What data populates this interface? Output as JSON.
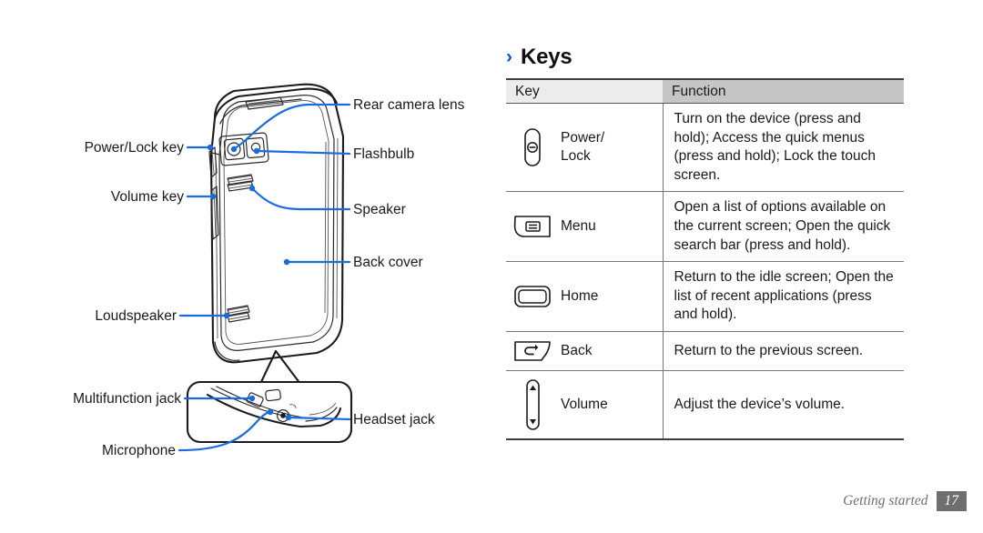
{
  "colors": {
    "accent_blue": "#0d4ff0",
    "leader_blue": "#1a6ae0",
    "header_key_bg": "#ececec",
    "header_function_bg": "#c6c6c6",
    "rule": "#777777",
    "footer_gray": "#6e6e6e",
    "ink": "#1a1a1a"
  },
  "heading": {
    "chevron": "›",
    "text": "Keys"
  },
  "diagram": {
    "labels_left": [
      {
        "text": "Power/Lock key",
        "name": "power-lock-key"
      },
      {
        "text": "Volume key",
        "name": "volume-key"
      },
      {
        "text": "Loudspeaker",
        "name": "loudspeaker"
      },
      {
        "text": "Multifunction jack",
        "name": "multifunction-jack"
      },
      {
        "text": "Microphone",
        "name": "microphone"
      }
    ],
    "labels_right": [
      {
        "text": "Rear camera lens",
        "name": "rear-camera-lens"
      },
      {
        "text": "Flashbulb",
        "name": "flashbulb"
      },
      {
        "text": "Speaker",
        "name": "speaker"
      },
      {
        "text": "Back cover",
        "name": "back-cover"
      },
      {
        "text": "Headset jack",
        "name": "headset-jack"
      }
    ]
  },
  "table": {
    "headers": {
      "key": "Key",
      "function": "Function"
    },
    "rows": [
      {
        "icon": "power-lock-key-icon",
        "name": "Power/\nLock",
        "name_lines": [
          "Power/",
          "Lock"
        ],
        "function": "Turn on the device (press and hold); Access the quick menus (press and hold); Lock the touch screen."
      },
      {
        "icon": "menu-key-icon",
        "name": "Menu",
        "name_lines": [
          "Menu"
        ],
        "function": "Open a list of options available on the current screen; Open the quick search bar (press and hold)."
      },
      {
        "icon": "home-key-icon",
        "name": "Home",
        "name_lines": [
          "Home"
        ],
        "function": "Return to the idle screen; Open the list of recent applications (press and hold)."
      },
      {
        "icon": "back-key-icon",
        "name": "Back",
        "name_lines": [
          "Back"
        ],
        "function": "Return to the previous screen."
      },
      {
        "icon": "volume-key-icon",
        "name": "Volume",
        "name_lines": [
          "Volume"
        ],
        "function": "Adjust the device’s volume."
      }
    ]
  },
  "footer": {
    "section": "Getting started",
    "page_number": "17"
  }
}
